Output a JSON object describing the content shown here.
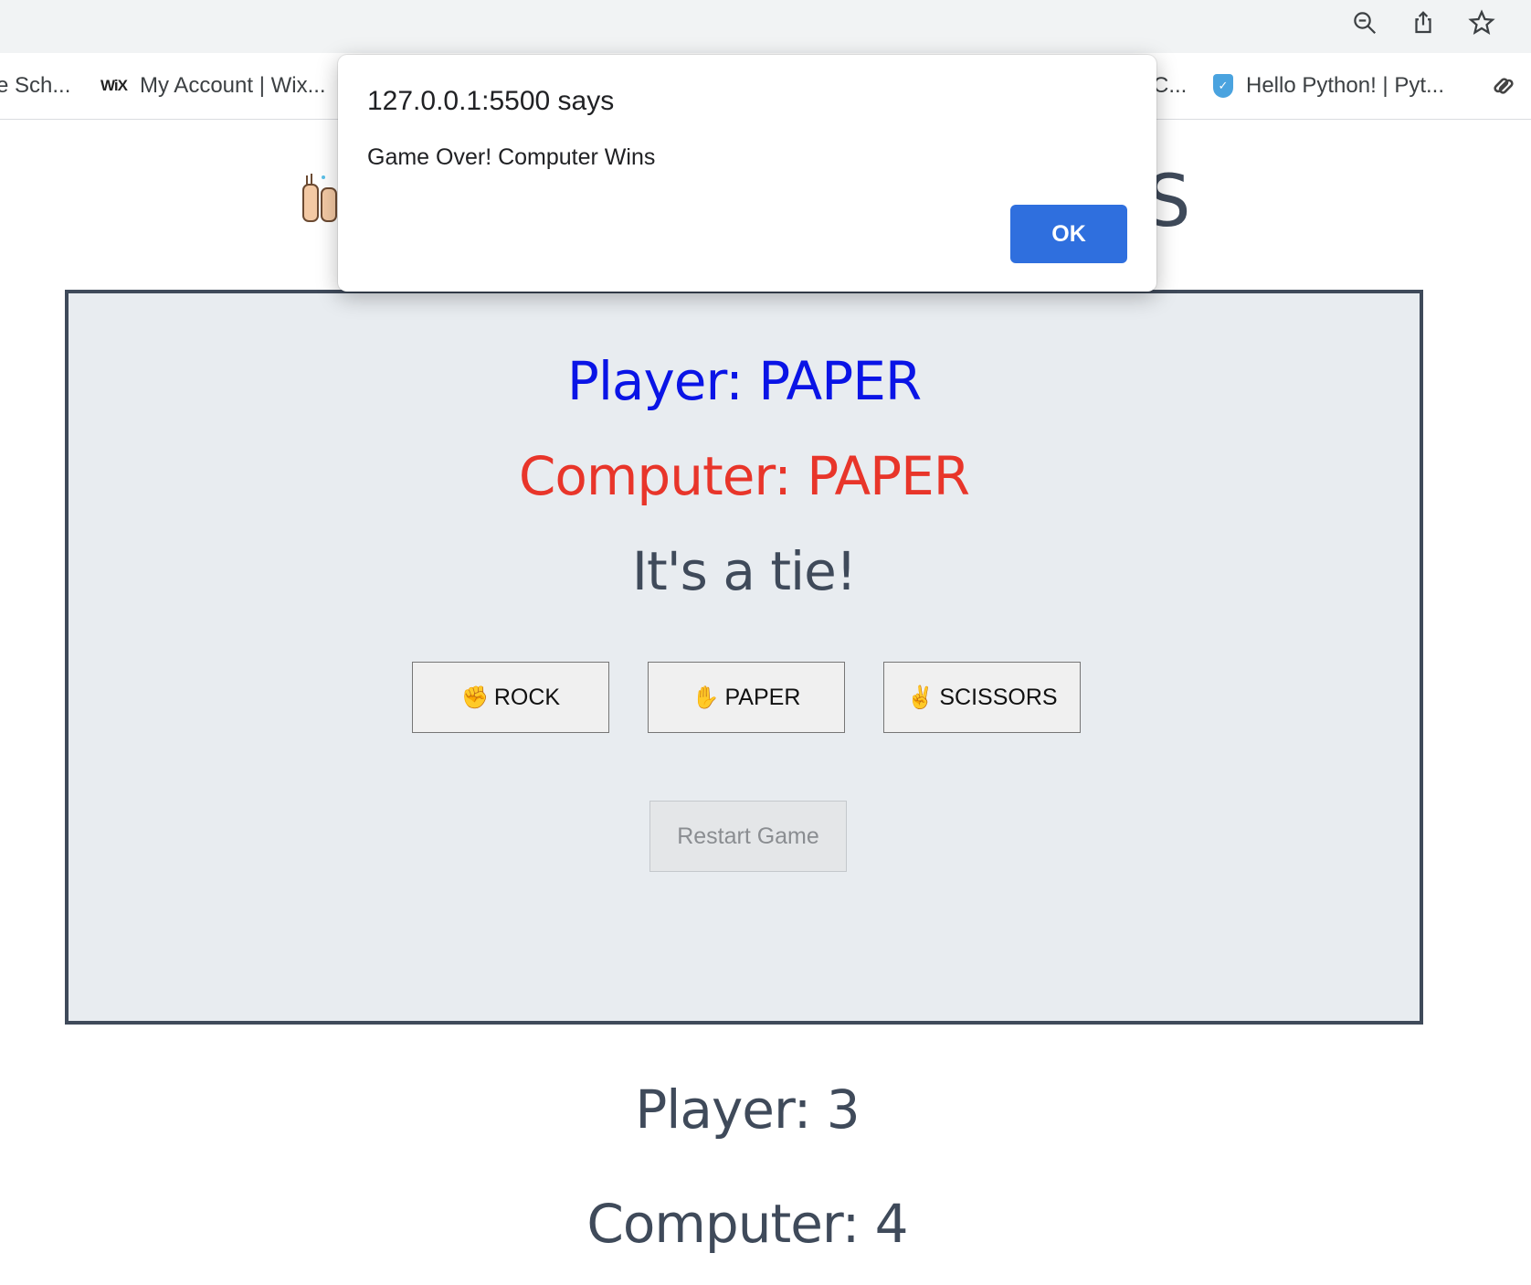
{
  "browser": {
    "toolbar_icons": [
      "zoom-out-icon",
      "share-icon",
      "bookmark-star-icon"
    ],
    "bookmarks": [
      {
        "label": "e Sch...",
        "icon": "none"
      },
      {
        "label": "My Account | Wix...",
        "icon": "wix-logo",
        "favicon_text": "WiX"
      },
      {
        "label": "C...",
        "icon": "none"
      },
      {
        "label": "Hello Python! | Pyt...",
        "icon": "shield-icon"
      }
    ]
  },
  "page": {
    "title_visible_tail": "S",
    "title_icon": "raised-hands-emoji",
    "player_choice": "Player: PAPER",
    "computer_choice": "Computer: PAPER",
    "result": "It's a tie!",
    "buttons": [
      {
        "label": "ROCK",
        "icon": "fist-icon"
      },
      {
        "label": "PAPER",
        "icon": "open-hand-icon"
      },
      {
        "label": "SCISSORS",
        "icon": "victory-hand-icon"
      }
    ],
    "restart_label": "Restart Game",
    "score_player": "Player: 3",
    "score_computer": "Computer: 4",
    "colors": {
      "player": "#0a14e6",
      "computer": "#e8352a",
      "text": "#3f4a5a",
      "box_bg": "#e8ecf0",
      "ok_button": "#2f6fde"
    }
  },
  "dialog": {
    "origin": "127.0.0.1:5500 says",
    "message": "Game Over! Computer Wins",
    "ok_label": "OK"
  }
}
